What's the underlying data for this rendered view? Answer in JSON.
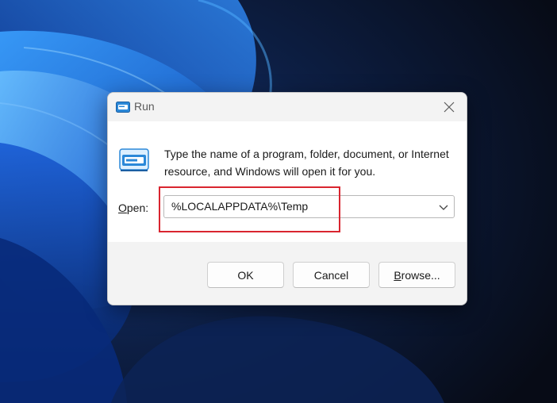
{
  "dialog": {
    "title": "Run",
    "description": "Type the name of a program, folder, document, or Internet resource, and Windows will open it for you.",
    "open_label_prefix": "O",
    "open_label_rest": "pen:",
    "open_value": "%LOCALAPPDATA%\\Temp",
    "buttons": {
      "ok": "OK",
      "cancel": "Cancel",
      "browse_prefix": "B",
      "browse_rest": "rowse..."
    }
  },
  "icons": {
    "title": "run-icon",
    "large": "run-icon",
    "close": "close-icon",
    "dropdown": "chevron-down-icon"
  },
  "colors": {
    "highlight": "#d9252f",
    "dialog_bg": "#f3f3f3",
    "wallpaper_dark": "#0a1020",
    "wallpaper_blue": "#1e6fe0"
  }
}
